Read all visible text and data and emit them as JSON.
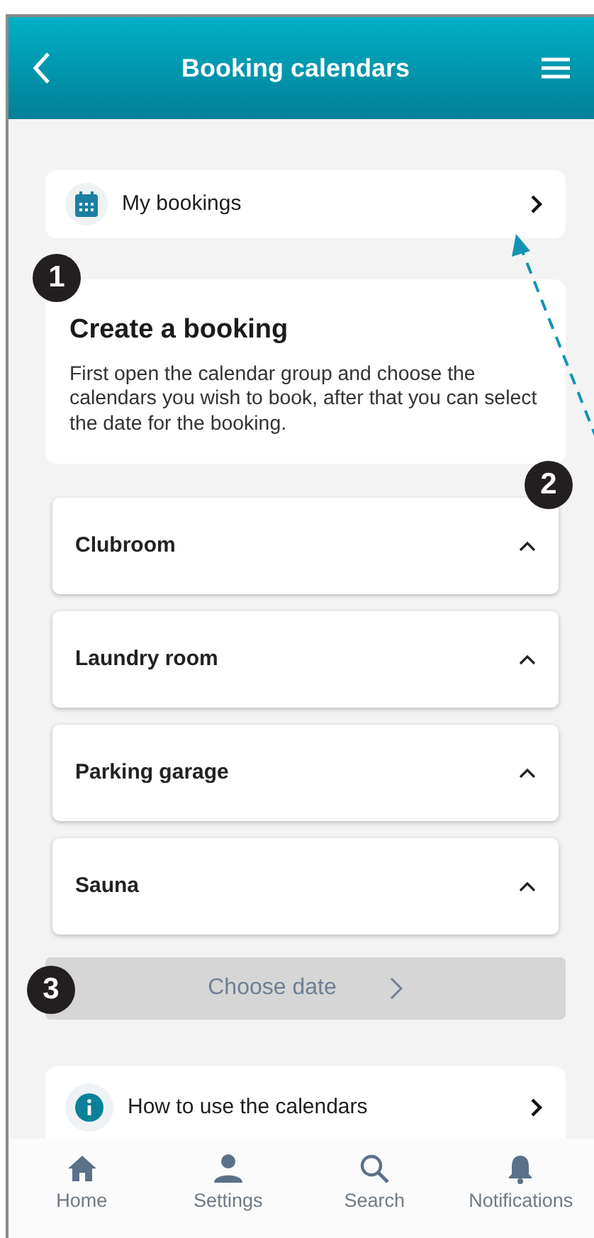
{
  "header": {
    "title": "Booking calendars"
  },
  "my_bookings": {
    "label": "My bookings"
  },
  "create_booking": {
    "title": "Create a booking",
    "text": "First open the calendar group and choose the calendars you wish to book, after that you can select the date for the booking."
  },
  "calendar_groups": [
    {
      "name": "Clubroom"
    },
    {
      "name": "Laundry room"
    },
    {
      "name": "Parking garage"
    },
    {
      "name": "Sauna"
    }
  ],
  "choose_date": {
    "label": "Choose date",
    "disabled": true
  },
  "help": {
    "label": "How to use the calendars"
  },
  "annotations": [
    "1",
    "2",
    "3"
  ],
  "bottom_nav": [
    {
      "label": "Home",
      "kind": "home"
    },
    {
      "label": "Settings",
      "kind": "person"
    },
    {
      "label": "Search",
      "kind": "search"
    },
    {
      "label": "Notifications",
      "kind": "bell"
    }
  ]
}
